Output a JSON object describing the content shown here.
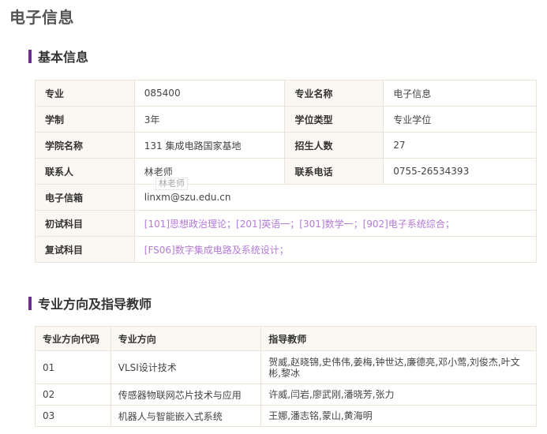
{
  "page": {
    "title": "电子信息"
  },
  "basic": {
    "heading": "基本信息",
    "rows": [
      {
        "l1": "专业",
        "v1": "085400",
        "l2": "专业名称",
        "v2": "电子信息"
      },
      {
        "l1": "学制",
        "v1": "3年",
        "l2": "学位类型",
        "v2": "专业学位"
      },
      {
        "l1": "学院名称",
        "v1": "131 集成电路国家基地",
        "l2": "招生人数",
        "v2": "27"
      },
      {
        "l1": "联系人",
        "v1": "林老师",
        "l2": "联系电话",
        "v2": "0755-26534393"
      }
    ],
    "email": {
      "label": "电子信箱",
      "value": "linxm@szu.edu.cn"
    },
    "first_exam": {
      "label": "初试科目",
      "value": "[101]思想政治理论；[201]英语一；[301]数学一；[902]电子系统综合；"
    },
    "retest": {
      "label": "复试科目",
      "value": "[FS06]数字集成电路及系统设计；"
    },
    "tooltip": "林老师"
  },
  "directions": {
    "heading": "专业方向及指导教师",
    "columns": [
      "专业方向代码",
      "专业方向",
      "指导教师"
    ],
    "rows": [
      {
        "code": "01",
        "name": "VLSI设计技术",
        "teachers": "贺威,赵晓锦,史伟伟,姜梅,钟世达,廉德亮,邓小莺,刘俊杰,叶文彬,黎冰"
      },
      {
        "code": "02",
        "name": "传感器物联网芯片技术与应用",
        "teachers": "许威,闫岩,廖武刚,潘晓芳,张力"
      },
      {
        "code": "03",
        "name": "机器人与智能嵌入式系统",
        "teachers": "王娜,潘志铭,蒙山,黄海明"
      }
    ]
  },
  "colors": {
    "accent": "#6c2f8f",
    "link": "#b47ad6",
    "label_bg": "#fbf8f4",
    "border": "#ece3d9"
  }
}
